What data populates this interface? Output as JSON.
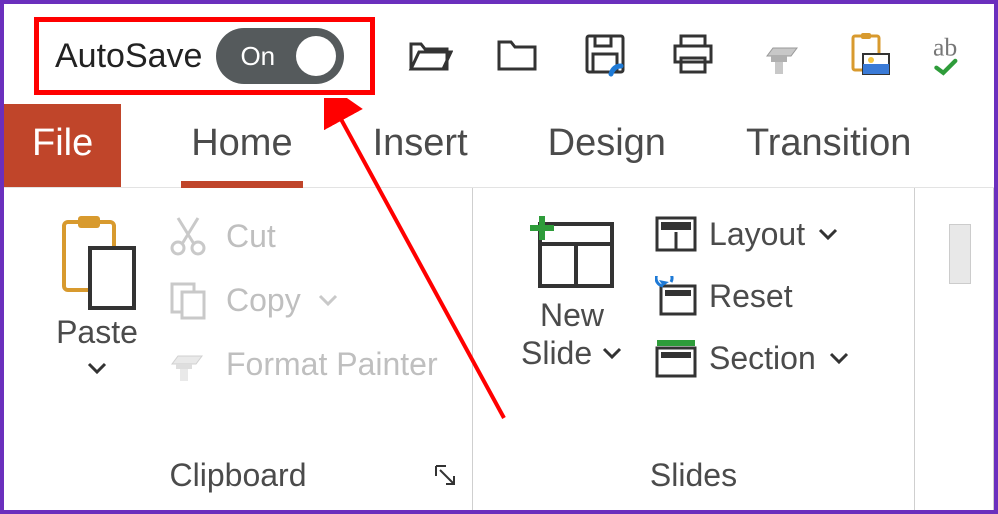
{
  "qat": {
    "autosave_label": "AutoSave",
    "autosave_state": "On"
  },
  "tabs": {
    "file": "File",
    "home": "Home",
    "insert": "Insert",
    "design": "Design",
    "transitions": "Transition"
  },
  "clipboard": {
    "paste": "Paste",
    "cut": "Cut",
    "copy": "Copy",
    "format_painter": "Format Painter",
    "group_label": "Clipboard"
  },
  "slides": {
    "new_slide": "New Slide",
    "layout": "Layout",
    "reset": "Reset",
    "section": "Section",
    "group_label": "Slides"
  }
}
